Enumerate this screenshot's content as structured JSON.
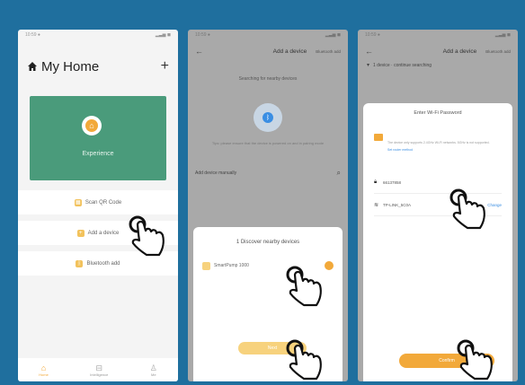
{
  "phone1": {
    "status_left": "10:59 ●",
    "status_right": "▂▃▅ ◼",
    "title": "My Home",
    "home_icon": "home-icon",
    "add_icon": "plus-icon",
    "experience_label": "Experience",
    "menu": [
      {
        "label": "Scan QR Code",
        "icon": "qr-icon"
      },
      {
        "label": "Add a device",
        "icon": "plus-icon"
      },
      {
        "label": "Bluetooth add",
        "icon": "bluetooth-icon"
      }
    ],
    "tabs": [
      {
        "label": "Home",
        "icon": "home-icon"
      },
      {
        "label": "Intelligence",
        "icon": "intelligence-icon"
      },
      {
        "label": "Me",
        "icon": "me-icon"
      }
    ]
  },
  "phone2": {
    "status_left": "10:59 ●",
    "status_right": "▂▃▅ ◼",
    "title": "Add a device",
    "subtitle": "Bluetooth add",
    "scanning_text": "Searching for nearby devices",
    "hint": "Tips: please ensure that the device is powered on and in pairing mode",
    "manual_label": "Add device manually",
    "sheet_title": "1 Discover nearby devices",
    "device_name": "SmartPump 1000",
    "next_label": "Next"
  },
  "phone3": {
    "status_left": "10:59 ●",
    "status_right": "▂▃▅ ◼",
    "title": "Add a device",
    "subtitle": "Bluetooth add",
    "status_text": "1 device · continue searching",
    "sheet_title": "Enter Wi-Fi Password",
    "note_text": "The device only supports 2.4GHz Wi-Fi networks. 5GHz is not supported.",
    "note_link": "Set router method",
    "password_value": "66137858",
    "wifi_name": "TP-LINK_5C0A",
    "change_label": "Change",
    "confirm_label": "Confirm"
  },
  "colors": {
    "background": "#1f6f9e",
    "accent": "#f2a93a",
    "card_green": "#4a9b7b"
  }
}
